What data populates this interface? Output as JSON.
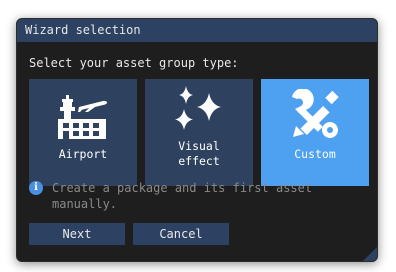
{
  "dialog": {
    "title": "Wizard selection",
    "prompt": "Select your asset group type:"
  },
  "tiles": [
    {
      "label": "Airport",
      "icon": "airport-icon",
      "selected": false
    },
    {
      "label": "Visual\neffect",
      "icon": "sparkles-icon",
      "selected": false
    },
    {
      "label": "Custom",
      "icon": "tools-icon",
      "selected": true
    }
  ],
  "info": {
    "icon": "info-icon",
    "glyph": "i",
    "text": "Create a package and its first asset manually."
  },
  "buttons": {
    "next": "Next",
    "cancel": "Cancel"
  },
  "colors": {
    "dialog_bg": "#1e1e1e",
    "titlebar": "#2d4162",
    "tile": "#2e4260",
    "tile_selected": "#4ea0f0",
    "info_icon": "#4a90e2",
    "info_text": "#8a8a8a"
  }
}
